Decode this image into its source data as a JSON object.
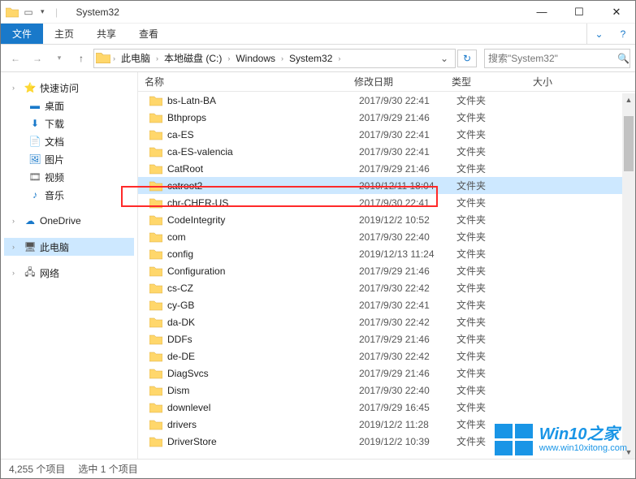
{
  "window": {
    "title": "System32"
  },
  "ribbon": {
    "file": "文件",
    "home": "主页",
    "share": "共享",
    "view": "查看"
  },
  "breadcrumbs": [
    "此电脑",
    "本地磁盘 (C:)",
    "Windows",
    "System32"
  ],
  "search": {
    "placeholder": "搜索\"System32\""
  },
  "sidebar": {
    "quick": "快速访问",
    "desktop": "桌面",
    "downloads": "下载",
    "documents": "文档",
    "pictures": "图片",
    "videos": "视频",
    "music": "音乐",
    "onedrive": "OneDrive",
    "thispc": "此电脑",
    "network": "网络"
  },
  "columns": {
    "name": "名称",
    "date": "修改日期",
    "type": "类型",
    "size": "大小"
  },
  "type_folder": "文件夹",
  "files": [
    {
      "name": "bs-Latn-BA",
      "date": "2017/9/30 22:41",
      "selected": false
    },
    {
      "name": "Bthprops",
      "date": "2017/9/29 21:46",
      "selected": false
    },
    {
      "name": "ca-ES",
      "date": "2017/9/30 22:41",
      "selected": false
    },
    {
      "name": "ca-ES-valencia",
      "date": "2017/9/30 22:41",
      "selected": false
    },
    {
      "name": "CatRoot",
      "date": "2017/9/29 21:46",
      "selected": false
    },
    {
      "name": "catroot2",
      "date": "2019/12/11 18:04",
      "selected": true
    },
    {
      "name": "chr-CHER-US",
      "date": "2017/9/30 22:41",
      "selected": false
    },
    {
      "name": "CodeIntegrity",
      "date": "2019/12/2 10:52",
      "selected": false
    },
    {
      "name": "com",
      "date": "2017/9/30 22:40",
      "selected": false
    },
    {
      "name": "config",
      "date": "2019/12/13 11:24",
      "selected": false
    },
    {
      "name": "Configuration",
      "date": "2017/9/29 21:46",
      "selected": false
    },
    {
      "name": "cs-CZ",
      "date": "2017/9/30 22:42",
      "selected": false
    },
    {
      "name": "cy-GB",
      "date": "2017/9/30 22:41",
      "selected": false
    },
    {
      "name": "da-DK",
      "date": "2017/9/30 22:42",
      "selected": false
    },
    {
      "name": "DDFs",
      "date": "2017/9/29 21:46",
      "selected": false
    },
    {
      "name": "de-DE",
      "date": "2017/9/30 22:42",
      "selected": false
    },
    {
      "name": "DiagSvcs",
      "date": "2017/9/29 21:46",
      "selected": false
    },
    {
      "name": "Dism",
      "date": "2017/9/30 22:40",
      "selected": false
    },
    {
      "name": "downlevel",
      "date": "2017/9/29 16:45",
      "selected": false
    },
    {
      "name": "drivers",
      "date": "2019/12/2 11:28",
      "selected": false
    },
    {
      "name": "DriverStore",
      "date": "2019/12/2 10:39",
      "selected": false
    }
  ],
  "status": {
    "count": "4,255 个项目",
    "selected": "选中 1 个项目"
  },
  "watermark": {
    "brand": "Win10之家",
    "url": "www.win10xitong.com"
  }
}
